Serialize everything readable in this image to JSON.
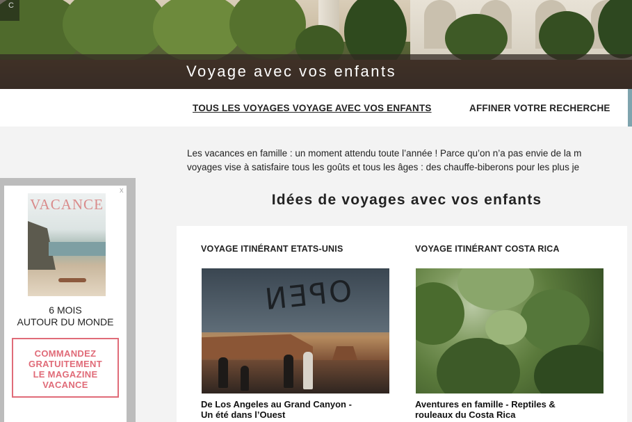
{
  "hero": {
    "corner_text": "C",
    "title": "Voyage avec vos enfants"
  },
  "nav": {
    "all_trips": "TOUS LES VOYAGES VOYAGE AVEC VOS ENFANTS",
    "refine": "AFFINER VOTRE RECHERCHE"
  },
  "intro": {
    "line1": "Les vacances en famille : un moment attendu toute l’année ! Parce qu’on n’a pas envie de la m",
    "line2": "voyages vise à satisfaire tous les goûts et tous les âges : des chauffe-biberons pour les plus je"
  },
  "section_title": "Idées de voyages avec vos enfants",
  "cards": [
    {
      "category": "VOYAGE ITINÉRANT ETATS-UNIS",
      "image_text": "OPEN",
      "title_line1": "De Los Angeles au Grand Canyon -",
      "title_line2": "Un été dans l’Ouest"
    },
    {
      "category": "VOYAGE ITINÉRANT COSTA RICA",
      "title_line1": "Aventures en famille - Reptiles &",
      "title_line2": "rouleaux du Costa Rica"
    }
  ],
  "ad": {
    "close": "x",
    "magazine_title": "VACANCE",
    "line1": "6 MOIS",
    "line2": "AUTOUR DU MONDE",
    "button_line1": "COMMANDEZ",
    "button_line2": "GRATUITEMENT",
    "button_line3": "LE MAGAZINE",
    "button_line4": "VACANCE",
    "accent": "#e06b78"
  }
}
